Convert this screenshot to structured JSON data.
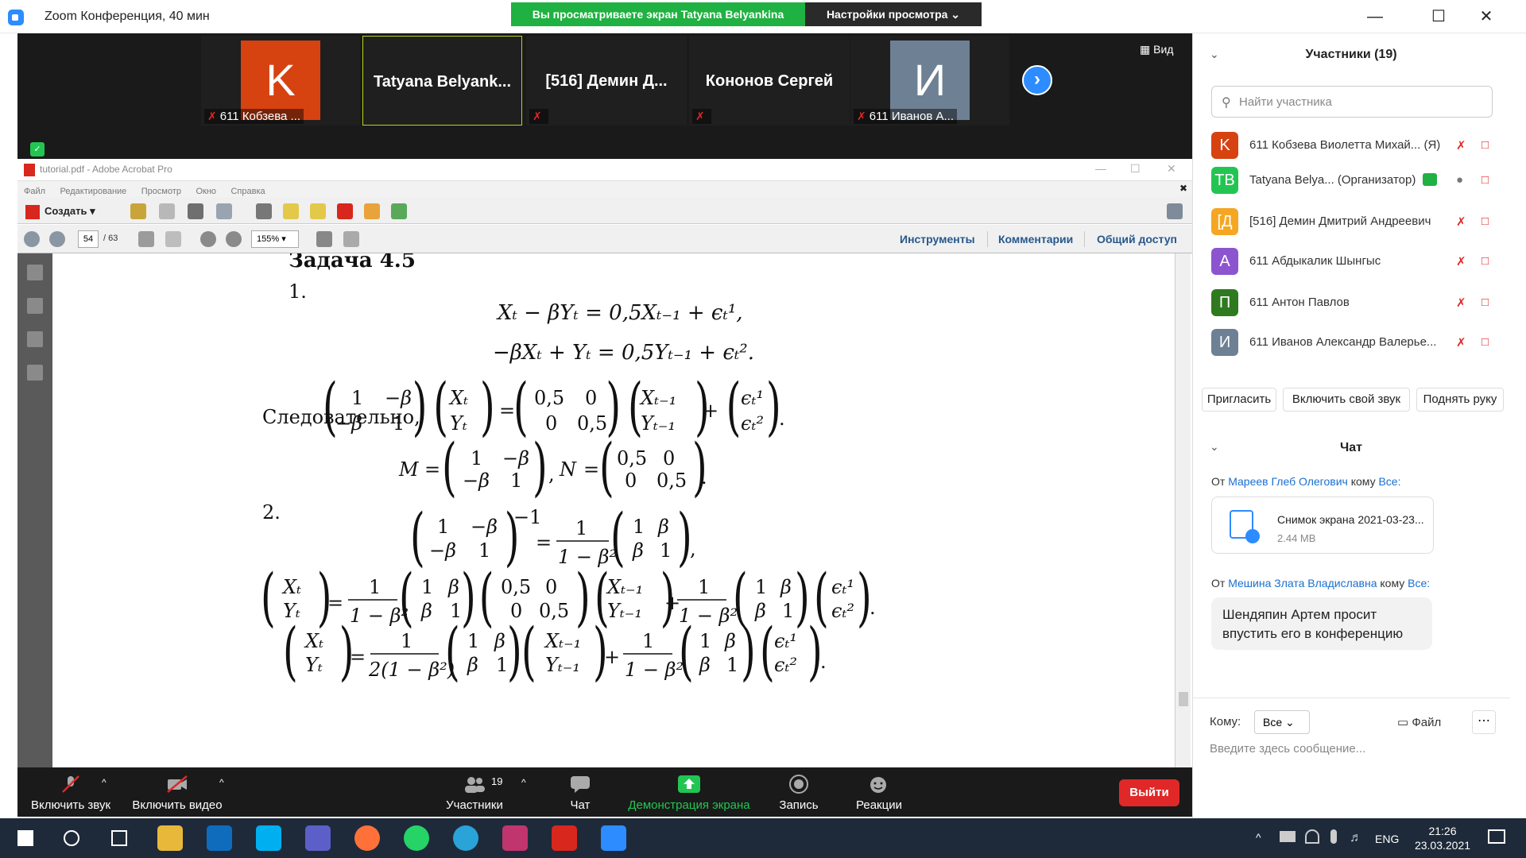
{
  "window": {
    "title": "Zoom Конференция, 40 мин",
    "viewing_banner": "Вы просматриваете экран Tatyana Belyankina",
    "view_options": "Настройки просмотра"
  },
  "video": {
    "view_label": "Вид",
    "tiles": [
      {
        "initial": "K",
        "avatar_color": "#d74211",
        "label": "611 Кобзева ..."
      },
      {
        "name": "Tatyana  Belyank..."
      },
      {
        "name": "[516] Демин Д..."
      },
      {
        "name": "Кононов Сергей"
      },
      {
        "initial": "И",
        "avatar_color": "#6e8093",
        "label": "611 Иванов А..."
      }
    ]
  },
  "acrobat": {
    "title": "tutorial.pdf - Adobe Acrobat Pro",
    "menu": [
      "Файл",
      "Редактирование",
      "Просмотр",
      "Окно",
      "Справка"
    ],
    "create": "Создать",
    "page_current": "54",
    "page_total": "/ 63",
    "zoom": "155%",
    "tabs": [
      "Инструменты",
      "Комментарии",
      "Общий доступ"
    ]
  },
  "pdf": {
    "heading": "Задача 4.5",
    "item1": "1.",
    "eq1": "Xₜ − βYₜ = 0,5Xₜ₋₁ + ϵₜ¹,",
    "eq2": "−βXₜ + Yₜ = 0,5Yₜ₋₁ + ϵₜ².",
    "therefore": "Следовательно,",
    "mn": "M = ( 1  −β ; −β  1 ),  N = ( 0,5  0 ; 0  0,5 ).",
    "item2": "2.",
    "inv_lhs": "( 1  −β ; −β  1 )⁻¹",
    "inv_rhs": "= 1/(1 − β²) ( 1  β ; β  1 ),",
    "eq4": "( Xₜ ; Yₜ ) = 1/(1 − β²) ( 1  β ; β  1 ) ( 0,5  0 ; 0  0,5 ) ( Xₜ₋₁ ; Yₜ₋₁ ) + 1/(1 − β²) ( 1  β ; β  1 ) ( ϵₜ¹ ; ϵₜ² ).",
    "eq5": "( Xₜ ; Yₜ ) = 1/(2(1 − β²)) ( 1  β ; β  1 ) ( Xₜ₋₁ ; Yₜ₋₁ ) + 1/(1 − β²) ( 1  β ; β  1 ) ( ϵₜ¹ ; ϵₜ² )."
  },
  "toolbar": {
    "mute": "Включить звук",
    "video": "Включить видео",
    "participants": "Участники",
    "participants_count": "19",
    "chat": "Чат",
    "share": "Демонстрация экрана",
    "record": "Запись",
    "reactions": "Реакции",
    "leave": "Выйти"
  },
  "panel": {
    "title": "Участники (19)",
    "search_placeholder": "Найти участника",
    "participants": [
      {
        "initials": "K",
        "color": "#d74211",
        "name": "611 Кобзева Виолетта Михай... (Я)"
      },
      {
        "initials": "ТВ",
        "color": "#23c552",
        "name": "Tatyana Belya... (Организатор)"
      },
      {
        "initials": "[Д",
        "color": "#f5a623",
        "name": "[516] Демин Дмитрий Андреевич"
      },
      {
        "initials": "А",
        "color": "#8d54cf",
        "name": "611 Абдыкалик Шынгыс"
      },
      {
        "initials": "П",
        "color": "#2f7a1e",
        "name": "611 Антон Павлов"
      },
      {
        "initials": "И",
        "color": "#6e8093",
        "name": "611 Иванов Александр Валерье..."
      }
    ],
    "invite": "Пригласить",
    "unmute_me": "Включить свой звук",
    "raise_hand": "Поднять руку",
    "chat_title": "Чат",
    "msg1_from_prefix": "От ",
    "msg1_from": "Мареев Глеб Олегович",
    "msg1_to": " кому ",
    "msg1_to_name": "Все:",
    "file_name": "Снимок экрана 2021-03-23...",
    "file_size": "2.44 MB",
    "msg2_from_prefix": "От ",
    "msg2_from": "Мешина Злата Владиславна",
    "msg2_to": " кому ",
    "msg2_to_name": "Все:",
    "msg2_text": "Шендяпин Артем просит впустить его в конференцию",
    "to_label": "Кому:",
    "to_value": "Все",
    "file_btn": "Файл",
    "input_placeholder": "Введите здесь сообщение..."
  },
  "taskbar": {
    "lang": "ENG",
    "time": "21:26",
    "date": "23.03.2021"
  }
}
